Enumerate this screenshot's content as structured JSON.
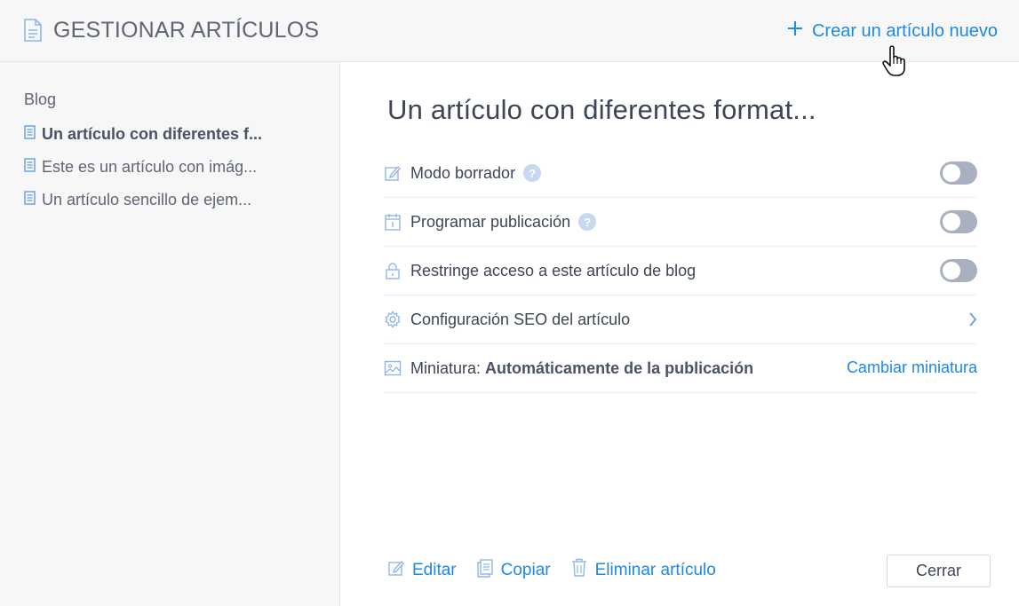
{
  "header": {
    "title": "GESTIONAR ARTÍCULOS",
    "create_label": "Crear un artículo nuevo"
  },
  "sidebar": {
    "heading": "Blog",
    "items": [
      {
        "label": "Un artículo con diferentes f...",
        "active": true
      },
      {
        "label": "Este es un artículo con imág...",
        "active": false
      },
      {
        "label": "Un artículo sencillo de ejem...",
        "active": false
      }
    ]
  },
  "main": {
    "title": "Un artículo con diferentes format...",
    "settings": {
      "draft_label": "Modo borrador",
      "draft_on": false,
      "schedule_label": "Programar publicación",
      "schedule_on": false,
      "restrict_label": "Restringe acceso a este artículo de blog",
      "restrict_on": false,
      "seo_label": "Configuración SEO del artículo",
      "thumbnail_label": "Miniatura:",
      "thumbnail_value": "Automáticamente de la publicación",
      "thumbnail_action": "Cambiar miniatura",
      "help_glyph": "?"
    },
    "actions": {
      "edit": "Editar",
      "copy": "Copiar",
      "delete": "Eliminar artículo",
      "close": "Cerrar"
    }
  },
  "colors": {
    "accent": "#1e88e5",
    "toggle_off": "#a9b1c0",
    "help_badge": "#c6d9f0"
  }
}
